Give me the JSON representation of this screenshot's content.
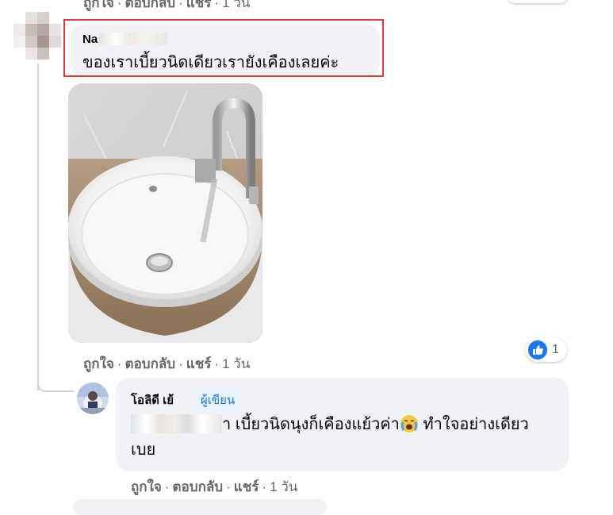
{
  "top_actions": {
    "like": "ถูกใจ",
    "reply": "ตอบกลับ",
    "share": "แชร์",
    "time": "1 วัน"
  },
  "comment1": {
    "author_partial": "Na",
    "text": "ของเราเบี้ยวนิดเดียวเรายังเคืองเลยค่ะ",
    "actions": {
      "like": "ถูกใจ",
      "reply": "ตอบกลับ",
      "share": "แชร์",
      "time": "1 วัน"
    },
    "reaction_count": "1",
    "highlight_color": "#e0393e"
  },
  "reply1": {
    "author": "โอลิดี เย้",
    "badge": "ผู้เขียน",
    "text_suffix": "า เบี้ยวนิดนุงก็เคืองแย้วค่า",
    "text_after_emoji": " ทำใจอย่างเดียว",
    "text_line2": "เบย",
    "actions": {
      "like": "ถูกใจ",
      "reply": "ตอบกลับ",
      "share": "แชร์",
      "time": "1 วัน"
    }
  },
  "separator": "·",
  "icons": [
    "like-reaction-icon",
    "crying-face-emoji-icon"
  ],
  "colors": {
    "like_blue": "#1877f2",
    "badge_bg": "#e7f3ff",
    "badge_text": "#1b74e4"
  }
}
